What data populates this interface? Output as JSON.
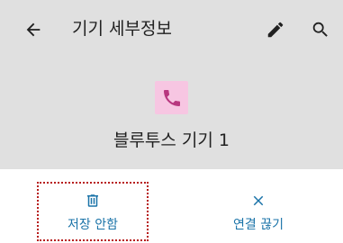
{
  "appbar": {
    "title": "기기 세부정보",
    "back_icon": "arrow-back-icon",
    "edit_icon": "pencil-icon",
    "search_icon": "search-icon"
  },
  "device": {
    "name": "블루투스 기기 1",
    "icon": "phone-icon",
    "icon_bg_color": "#f7c6e2",
    "icon_color": "#b8377f"
  },
  "actions": [
    {
      "label": "저장 안함",
      "icon": "trash-icon"
    },
    {
      "label": "연결 끊기",
      "icon": "close-icon"
    }
  ],
  "colors": {
    "header_bg": "#e0e0e0",
    "accent": "#1a73a8",
    "highlight_border": "#b71c1c"
  }
}
